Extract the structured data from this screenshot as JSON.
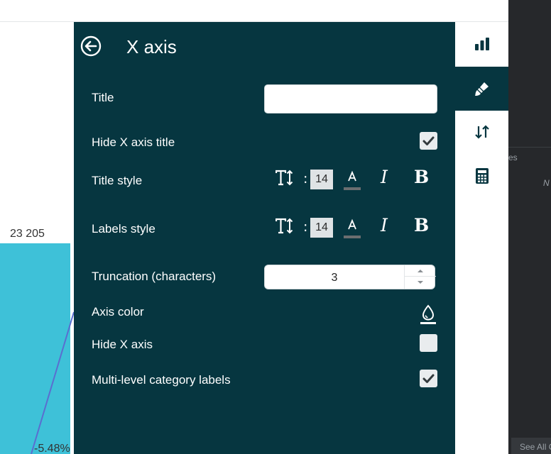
{
  "background_chart": {
    "bar_value_label": "23 205",
    "pct_label": "-5.48%",
    "bar_color": "#3ec1d8",
    "line_color": "#5a6ed0"
  },
  "right_panel": {
    "column_header_fragment": "es",
    "cell_fragment": "N",
    "see_all_label": "See All C"
  },
  "rail": {
    "items": [
      {
        "icon": "bar-chart-icon",
        "active": false
      },
      {
        "icon": "paintbrush-icon",
        "active": true
      },
      {
        "icon": "sort-arrows-icon",
        "active": false
      },
      {
        "icon": "calculator-icon",
        "active": false
      }
    ]
  },
  "panel": {
    "title": "X axis",
    "bg_color": "#063640",
    "title_field": {
      "label": "Title",
      "value": "",
      "placeholder": ""
    },
    "hide_title": {
      "label": "Hide X axis title",
      "checked": true
    },
    "title_style": {
      "label": "Title style",
      "font_size": "14",
      "colon": ":"
    },
    "labels_style": {
      "label": "Labels style",
      "font_size": "14",
      "colon": ":"
    },
    "truncation": {
      "label": "Truncation (characters)",
      "value": "3"
    },
    "axis_color": {
      "label": "Axis color",
      "icon": "droplet-icon"
    },
    "hide_axis": {
      "label": "Hide X axis",
      "checked": false
    },
    "multi_level": {
      "label": "Multi-level category labels",
      "checked": true
    }
  }
}
